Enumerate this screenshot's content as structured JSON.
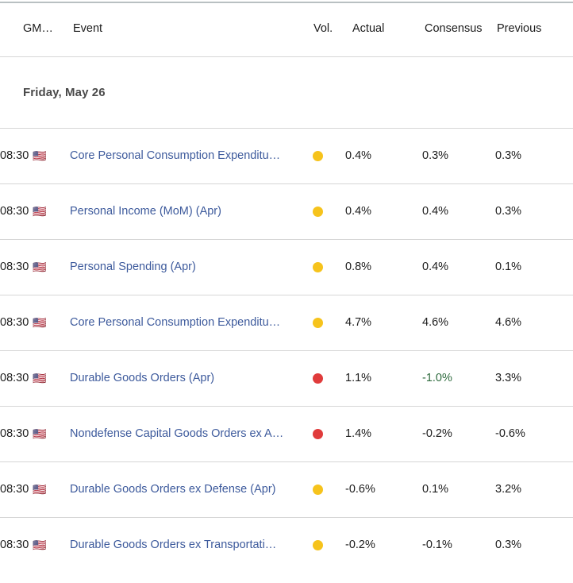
{
  "table": {
    "columns": [
      {
        "key": "time",
        "label": "GM…",
        "full_label": "GMT"
      },
      {
        "key": "event",
        "label": "Event"
      },
      {
        "key": "vol",
        "label": "Vol."
      },
      {
        "key": "actual",
        "label": "Actual"
      },
      {
        "key": "consensus",
        "label": "Consensus"
      },
      {
        "key": "previous",
        "label": "Previous"
      }
    ],
    "date_group": "Friday, May 26",
    "flag_icon": "us-flag-icon",
    "flag_glyph": "🇺🇸",
    "rows": [
      {
        "time": "08:30",
        "country": "United States",
        "event": "Core Personal Consumption Expenditu…",
        "volatility": "medium",
        "actual": "0.4%",
        "consensus": "0.3%",
        "previous": "0.3%",
        "consensus_negative": false
      },
      {
        "time": "08:30",
        "country": "United States",
        "event": "Personal Income (MoM) (Apr)",
        "volatility": "medium",
        "actual": "0.4%",
        "consensus": "0.4%",
        "previous": "0.3%",
        "consensus_negative": false
      },
      {
        "time": "08:30",
        "country": "United States",
        "event": "Personal Spending (Apr)",
        "volatility": "medium",
        "actual": "0.8%",
        "consensus": "0.4%",
        "previous": "0.1%",
        "consensus_negative": false
      },
      {
        "time": "08:30",
        "country": "United States",
        "event": "Core Personal Consumption Expenditu…",
        "volatility": "medium",
        "actual": "4.7%",
        "consensus": "4.6%",
        "previous": "4.6%",
        "consensus_negative": false
      },
      {
        "time": "08:30",
        "country": "United States",
        "event": "Durable Goods Orders (Apr)",
        "volatility": "high",
        "actual": "1.1%",
        "consensus": "-1.0%",
        "previous": "3.3%",
        "consensus_negative": true
      },
      {
        "time": "08:30",
        "country": "United States",
        "event": "Nondefense Capital Goods Orders ex A…",
        "volatility": "high",
        "actual": "1.4%",
        "consensus": "-0.2%",
        "previous": "-0.6%",
        "consensus_negative": false
      },
      {
        "time": "08:30",
        "country": "United States",
        "event": "Durable Goods Orders ex Defense (Apr)",
        "volatility": "medium",
        "actual": "-0.6%",
        "consensus": "0.1%",
        "previous": "3.2%",
        "consensus_negative": false
      },
      {
        "time": "08:30",
        "country": "United States",
        "event": "Durable Goods Orders ex Transportati…",
        "volatility": "medium",
        "actual": "-0.2%",
        "consensus": "-0.1%",
        "previous": "0.3%",
        "consensus_negative": false
      }
    ]
  },
  "colors": {
    "link": "#3d5a9c",
    "volatility_medium": "#f6c31c",
    "volatility_high": "#e03b3b",
    "rule": "#d6d6d6",
    "top_rule": "#b9c0c2",
    "text": "#1c1c1c",
    "date_text": "#4a4a4a",
    "negative_green": "#2e6b3e"
  }
}
